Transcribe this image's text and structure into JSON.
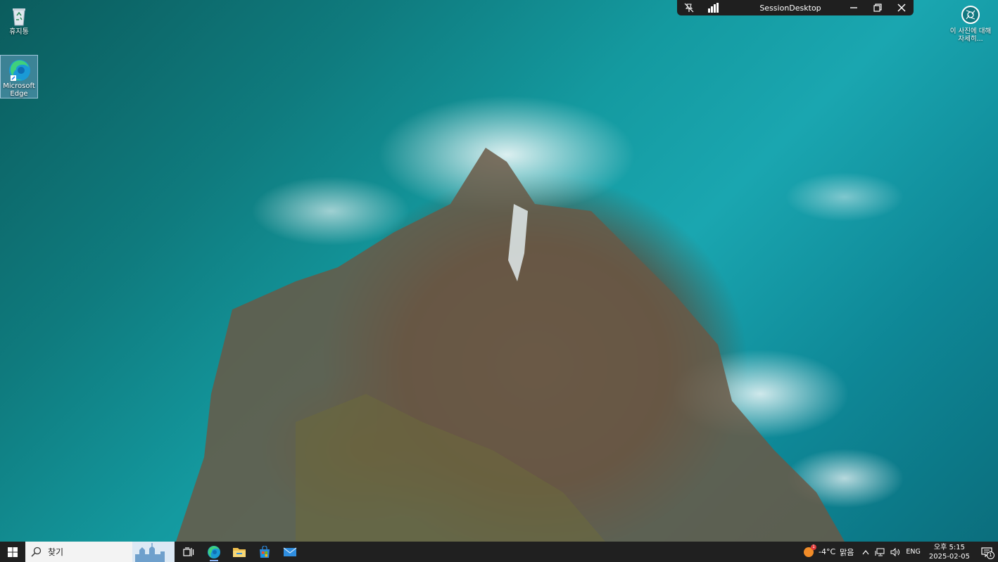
{
  "desktop": {
    "icons": [
      {
        "label": "휴지통",
        "icon": "recycle-bin-icon"
      },
      {
        "label": "Microsoft Edge",
        "icon": "edge-icon"
      }
    ],
    "photo_info": {
      "label": "이 사진에 대해 자세히...",
      "icon": "camera-info-icon"
    }
  },
  "session_bar": {
    "title": "SessionDesktop",
    "pin_icon": "unpin-icon",
    "signal_icon": "signal-bars-icon",
    "minimize_icon": "minimize-icon",
    "restore_icon": "restore-icon",
    "close_icon": "close-icon"
  },
  "taskbar": {
    "search_placeholder": "찾기",
    "apps": [
      "task-view-icon",
      "edge-icon",
      "file-explorer-icon",
      "store-icon",
      "mail-icon"
    ],
    "weather": {
      "temp": "-4°C",
      "condition": "맑음",
      "badge": "1"
    },
    "tray": {
      "language": "ENG"
    },
    "clock": {
      "time": "오후 5:15",
      "date": "2025-02-05"
    },
    "notifications": {
      "count": "1"
    }
  },
  "colors": {
    "taskbar_bg": "#202020",
    "session_bar_bg": "#1f1f1f",
    "search_bg": "#f3f3f3",
    "sea": "#149aa0"
  }
}
